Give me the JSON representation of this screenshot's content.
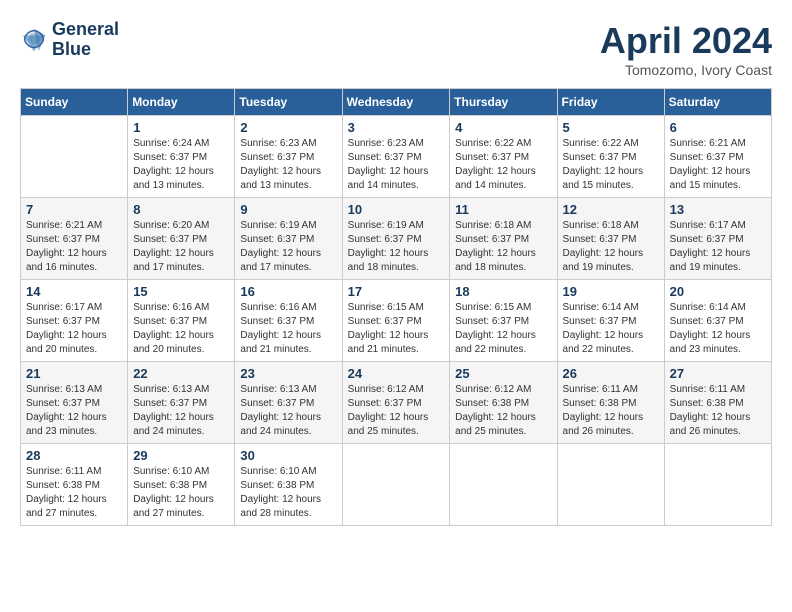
{
  "logo": {
    "line1": "General",
    "line2": "Blue"
  },
  "title": "April 2024",
  "location": "Tomozomo, Ivory Coast",
  "days_header": [
    "Sunday",
    "Monday",
    "Tuesday",
    "Wednesday",
    "Thursday",
    "Friday",
    "Saturday"
  ],
  "weeks": [
    [
      {
        "day": "",
        "info": ""
      },
      {
        "day": "1",
        "info": "Sunrise: 6:24 AM\nSunset: 6:37 PM\nDaylight: 12 hours\nand 13 minutes."
      },
      {
        "day": "2",
        "info": "Sunrise: 6:23 AM\nSunset: 6:37 PM\nDaylight: 12 hours\nand 13 minutes."
      },
      {
        "day": "3",
        "info": "Sunrise: 6:23 AM\nSunset: 6:37 PM\nDaylight: 12 hours\nand 14 minutes."
      },
      {
        "day": "4",
        "info": "Sunrise: 6:22 AM\nSunset: 6:37 PM\nDaylight: 12 hours\nand 14 minutes."
      },
      {
        "day": "5",
        "info": "Sunrise: 6:22 AM\nSunset: 6:37 PM\nDaylight: 12 hours\nand 15 minutes."
      },
      {
        "day": "6",
        "info": "Sunrise: 6:21 AM\nSunset: 6:37 PM\nDaylight: 12 hours\nand 15 minutes."
      }
    ],
    [
      {
        "day": "7",
        "info": "Sunrise: 6:21 AM\nSunset: 6:37 PM\nDaylight: 12 hours\nand 16 minutes."
      },
      {
        "day": "8",
        "info": "Sunrise: 6:20 AM\nSunset: 6:37 PM\nDaylight: 12 hours\nand 17 minutes."
      },
      {
        "day": "9",
        "info": "Sunrise: 6:19 AM\nSunset: 6:37 PM\nDaylight: 12 hours\nand 17 minutes."
      },
      {
        "day": "10",
        "info": "Sunrise: 6:19 AM\nSunset: 6:37 PM\nDaylight: 12 hours\nand 18 minutes."
      },
      {
        "day": "11",
        "info": "Sunrise: 6:18 AM\nSunset: 6:37 PM\nDaylight: 12 hours\nand 18 minutes."
      },
      {
        "day": "12",
        "info": "Sunrise: 6:18 AM\nSunset: 6:37 PM\nDaylight: 12 hours\nand 19 minutes."
      },
      {
        "day": "13",
        "info": "Sunrise: 6:17 AM\nSunset: 6:37 PM\nDaylight: 12 hours\nand 19 minutes."
      }
    ],
    [
      {
        "day": "14",
        "info": "Sunrise: 6:17 AM\nSunset: 6:37 PM\nDaylight: 12 hours\nand 20 minutes."
      },
      {
        "day": "15",
        "info": "Sunrise: 6:16 AM\nSunset: 6:37 PM\nDaylight: 12 hours\nand 20 minutes."
      },
      {
        "day": "16",
        "info": "Sunrise: 6:16 AM\nSunset: 6:37 PM\nDaylight: 12 hours\nand 21 minutes."
      },
      {
        "day": "17",
        "info": "Sunrise: 6:15 AM\nSunset: 6:37 PM\nDaylight: 12 hours\nand 21 minutes."
      },
      {
        "day": "18",
        "info": "Sunrise: 6:15 AM\nSunset: 6:37 PM\nDaylight: 12 hours\nand 22 minutes."
      },
      {
        "day": "19",
        "info": "Sunrise: 6:14 AM\nSunset: 6:37 PM\nDaylight: 12 hours\nand 22 minutes."
      },
      {
        "day": "20",
        "info": "Sunrise: 6:14 AM\nSunset: 6:37 PM\nDaylight: 12 hours\nand 23 minutes."
      }
    ],
    [
      {
        "day": "21",
        "info": "Sunrise: 6:13 AM\nSunset: 6:37 PM\nDaylight: 12 hours\nand 23 minutes."
      },
      {
        "day": "22",
        "info": "Sunrise: 6:13 AM\nSunset: 6:37 PM\nDaylight: 12 hours\nand 24 minutes."
      },
      {
        "day": "23",
        "info": "Sunrise: 6:13 AM\nSunset: 6:37 PM\nDaylight: 12 hours\nand 24 minutes."
      },
      {
        "day": "24",
        "info": "Sunrise: 6:12 AM\nSunset: 6:37 PM\nDaylight: 12 hours\nand 25 minutes."
      },
      {
        "day": "25",
        "info": "Sunrise: 6:12 AM\nSunset: 6:38 PM\nDaylight: 12 hours\nand 25 minutes."
      },
      {
        "day": "26",
        "info": "Sunrise: 6:11 AM\nSunset: 6:38 PM\nDaylight: 12 hours\nand 26 minutes."
      },
      {
        "day": "27",
        "info": "Sunrise: 6:11 AM\nSunset: 6:38 PM\nDaylight: 12 hours\nand 26 minutes."
      }
    ],
    [
      {
        "day": "28",
        "info": "Sunrise: 6:11 AM\nSunset: 6:38 PM\nDaylight: 12 hours\nand 27 minutes."
      },
      {
        "day": "29",
        "info": "Sunrise: 6:10 AM\nSunset: 6:38 PM\nDaylight: 12 hours\nand 27 minutes."
      },
      {
        "day": "30",
        "info": "Sunrise: 6:10 AM\nSunset: 6:38 PM\nDaylight: 12 hours\nand 28 minutes."
      },
      {
        "day": "",
        "info": ""
      },
      {
        "day": "",
        "info": ""
      },
      {
        "day": "",
        "info": ""
      },
      {
        "day": "",
        "info": ""
      }
    ]
  ]
}
